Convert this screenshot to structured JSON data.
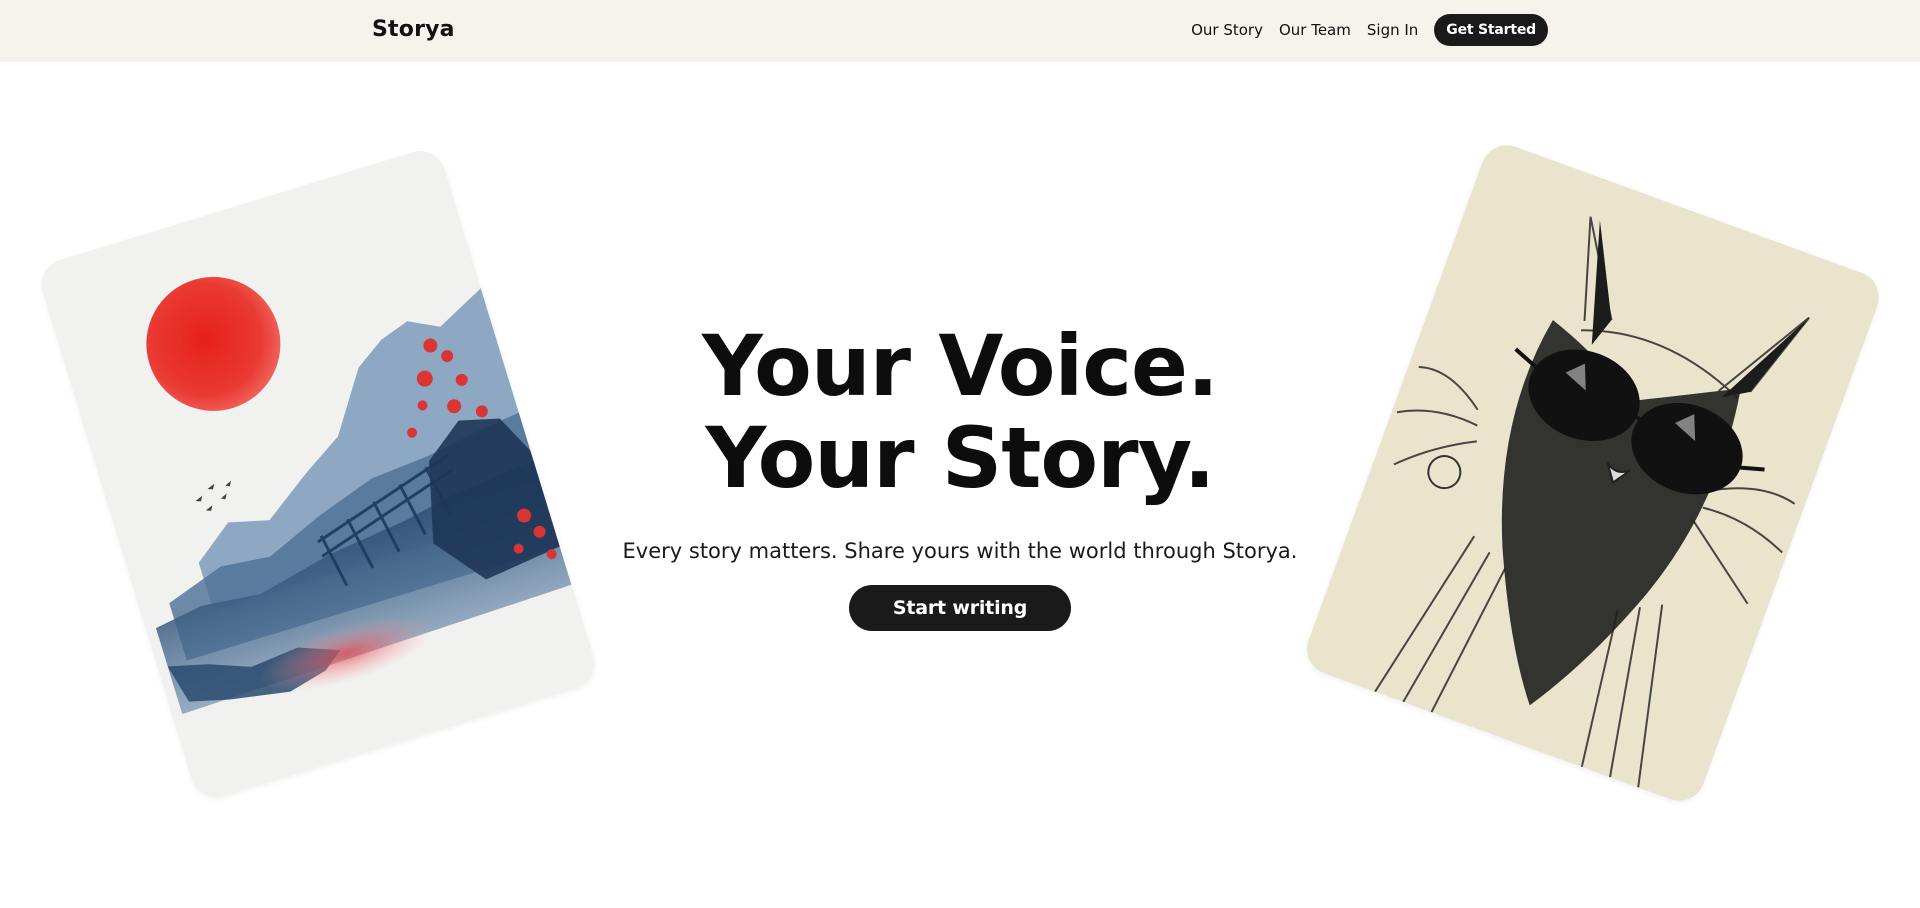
{
  "header": {
    "brand": "Storya",
    "nav": {
      "our_story": "Our Story",
      "our_team": "Our Team",
      "sign_in": "Sign In",
      "get_started": "Get Started"
    }
  },
  "hero": {
    "headline_line1": "Your Voice.",
    "headline_line2": "Your Story.",
    "subtitle": "Every story matters. Share yours with the world through Storya.",
    "cta": "Start writing"
  },
  "colors": {
    "header_bg": "#f6f3ed",
    "button_bg": "#1a1a1a",
    "text": "#111111",
    "sun_red": "#e8332e",
    "ink_blue": "#3d5f85",
    "paper_cream": "#e9e2cb"
  },
  "images": {
    "left_card": "watercolor-landscape-red-sun",
    "right_card": "ink-sketch-cat-sunglasses"
  }
}
